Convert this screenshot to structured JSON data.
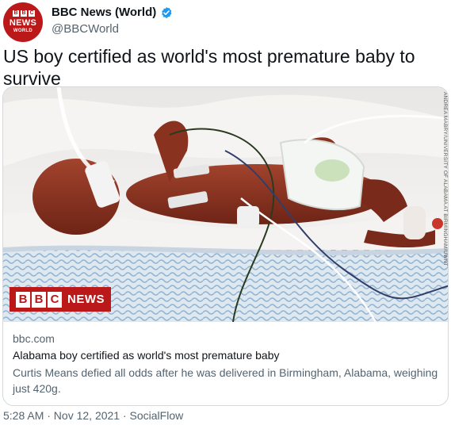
{
  "author": {
    "display_name": "BBC News (World)",
    "handle": "@BBCWorld",
    "avatar": {
      "blocks": [
        "B",
        "B",
        "C"
      ],
      "line1": "NEWS",
      "line2": "WORLD"
    },
    "verified_icon": "verified-badge-icon"
  },
  "tweet": {
    "text": "US boy certified as world's most premature baby to survive"
  },
  "card": {
    "image_icon": "baby-photo",
    "badge": {
      "blocks": [
        "B",
        "B",
        "C"
      ],
      "label": "NEWS"
    },
    "photo_credit": "ANDREA MABRY/UNIVERSITY OF ALABAMA AT BIRMINGHAM/UWNT",
    "domain": "bbc.com",
    "title": "Alabama boy certified as world's most premature baby",
    "description": "Curtis Means defied all odds after he was delivered in Birmingham, Alabama, weighing just 420g."
  },
  "meta": {
    "line": "5:28 AM · Nov 12, 2021 · SocialFlow"
  },
  "colors": {
    "bbc_red": "#bb1919",
    "verified_blue": "#1d9bf0",
    "secondary_text": "#536471"
  }
}
